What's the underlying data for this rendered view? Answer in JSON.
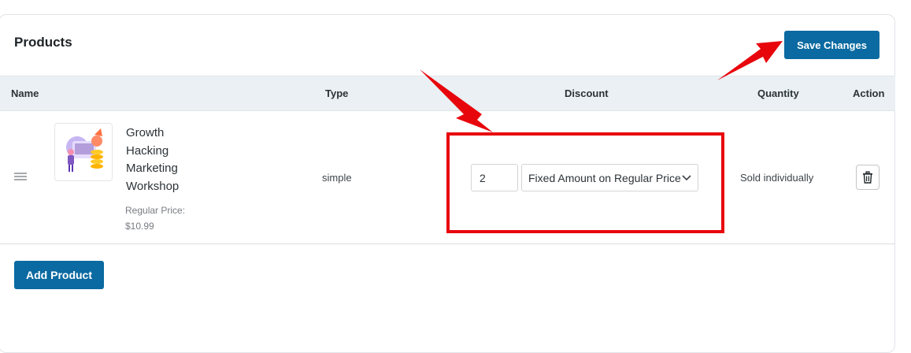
{
  "panel": {
    "title": "Products",
    "save_label": "Save Changes",
    "add_label": "Add Product"
  },
  "table": {
    "columns": [
      "Name",
      "Type",
      "Discount",
      "Quantity",
      "Action"
    ],
    "rows": [
      {
        "name": "Growth Hacking Marketing Workshop",
        "price_label": "Regular Price: $10.99",
        "type": "simple",
        "discount_value": "2",
        "discount_type": "Fixed Amount on Regular Price",
        "quantity": "Sold individually"
      }
    ]
  },
  "icons": {
    "drag": "drag-handle-icon",
    "thumbnail": "product-thumbnail",
    "dropdown": "chevron-down-icon",
    "delete": "trash-icon"
  },
  "colors": {
    "primary": "#0a6aa1",
    "annotation": "#e8060d",
    "header_bg": "#eaf0f3"
  }
}
